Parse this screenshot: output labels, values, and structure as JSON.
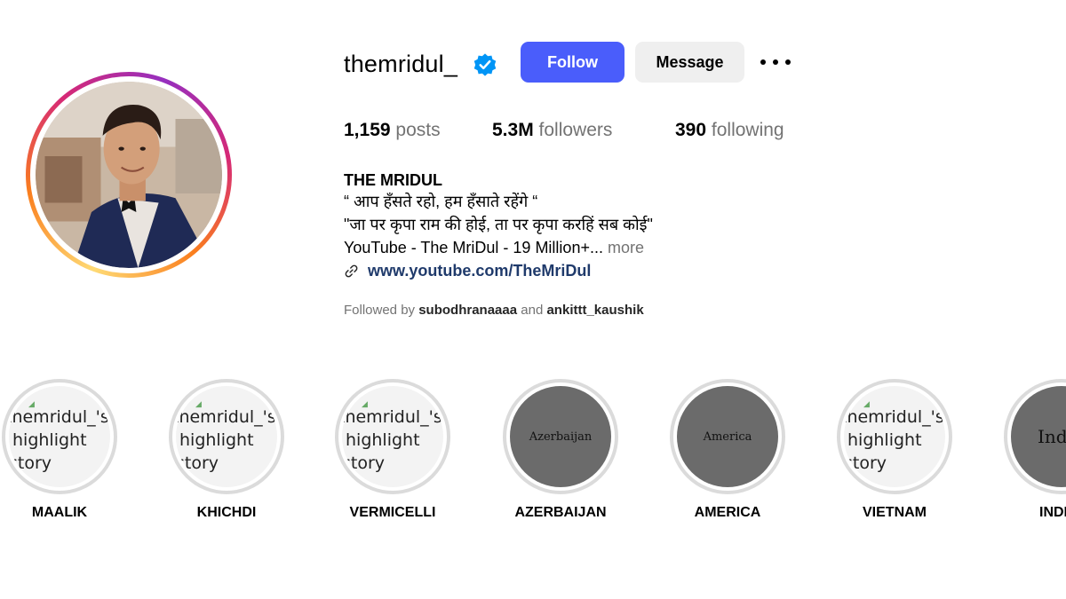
{
  "profile": {
    "username": "themridul_",
    "verified": true,
    "follow_label": "Follow",
    "message_label": "Message",
    "stats": {
      "posts_count": "1,159",
      "posts_label": "posts",
      "followers_count": "5.3M",
      "followers_label": "followers",
      "following_count": "390",
      "following_label": "following"
    },
    "bio": {
      "name": "THE MRIDUL",
      "line1": "“ आप हँसते रहो, हम हँसाते रहेंगे “",
      "line2": "\"जा पर कृपा राम की होई, ता पर कृपा करहिं सब कोई\"",
      "line3": "YouTube - The MriDul - 19 Million+...",
      "more": "more",
      "link": "www.youtube.com/TheMriDul"
    },
    "followed_by": {
      "prefix": "Followed by",
      "user1": "subodhranaaaa",
      "conj": "and",
      "user2": "ankittt_kaushik"
    }
  },
  "highlights": [
    {
      "label": "MAALIK",
      "alt_line1": "themridul_'s",
      "alt_line2": "highlight",
      "alt_line3": "story"
    },
    {
      "label": "KHICHDI",
      "alt_line1": "themridul_'s",
      "alt_line2": "highlight",
      "alt_line3": "story"
    },
    {
      "label": "VERMICELLI",
      "alt_line1": "themridul_'s",
      "alt_line2": "highlight",
      "alt_line3": "story"
    },
    {
      "label": "AZERBAIJAN",
      "image_text": "Azerbaijan"
    },
    {
      "label": "AMERICA",
      "image_text": "America"
    },
    {
      "label": "VIETNAM",
      "alt_line1": "themridul_'s",
      "alt_line2": "highlight",
      "alt_line3": "story"
    },
    {
      "label": "INDIA",
      "image_text": "India"
    }
  ],
  "colors": {
    "follow_button": "#4a5dfb",
    "message_button": "#efefef",
    "verified_badge": "#0095f6",
    "link": "#1f3a6b",
    "muted_text": "#737373"
  },
  "icons": {
    "verified": "verified-badge-icon",
    "more": "more-options-icon",
    "link": "link-icon"
  }
}
